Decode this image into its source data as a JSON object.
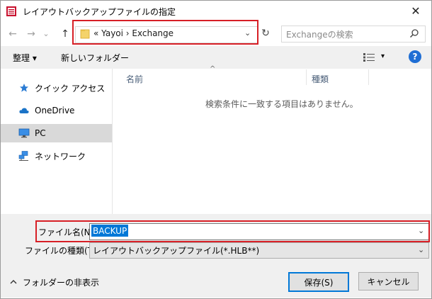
{
  "window": {
    "title": "レイアウトバックアップファイルの指定",
    "close_glyph": "✕"
  },
  "nav": {
    "back_glyph": "←",
    "forward_glyph": "→",
    "recent_glyph": "⌄",
    "up_glyph": "↑"
  },
  "address": {
    "path_text": "«  Yayoi  ›  Exchange",
    "dropdown_glyph": "⌄",
    "refresh_glyph": "↻"
  },
  "search": {
    "placeholder": "Exchangeの検索"
  },
  "toolbar": {
    "organize_label": "整理 ▾",
    "new_folder_label": "新しいフォルダー",
    "view_dropdown_glyph": "▾",
    "help_glyph": "?"
  },
  "sidebar": {
    "items": [
      {
        "label": "クイック アクセス",
        "icon": "star-icon"
      },
      {
        "label": "OneDrive",
        "icon": "cloud-icon"
      },
      {
        "label": "PC",
        "icon": "monitor-icon",
        "selected": true
      },
      {
        "label": "ネットワーク",
        "icon": "network-icon"
      }
    ]
  },
  "file_list": {
    "columns": [
      "名前",
      "種類"
    ],
    "sort_glyph": "^",
    "empty_message": "検索条件に一致する項目はありません。"
  },
  "form": {
    "filename_label": "ファイル名(N):",
    "filename_value": "BACKUP",
    "filetype_label": "ファイルの種類(T):",
    "filetype_value": "レイアウトバックアップファイル(*.HLB**)",
    "dropdown_glyph": "⌄"
  },
  "footer": {
    "hide_folders_label": "フォルダーの非表示",
    "save_label": "保存(S)",
    "cancel_label": "キャンセル"
  },
  "colors": {
    "highlight": "#d71f26",
    "accent": "#0078d7",
    "command_bar": "#f0f0f0"
  }
}
